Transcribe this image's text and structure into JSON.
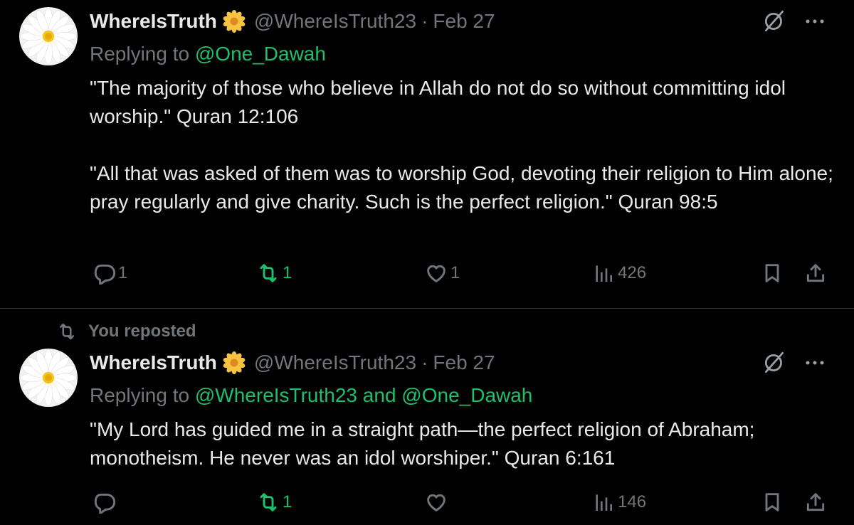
{
  "colors": {
    "background": "#000000",
    "text": "#e7e9ea",
    "muted": "#71767b",
    "accent": "#1fbf6b",
    "divider": "#2f3336"
  },
  "tweets": [
    {
      "name": "WhereIsTruth",
      "badge_icon": "daisy-flower",
      "handle": "@WhereIsTruth23",
      "sep": "·",
      "date": "Feb 27",
      "replying_prefix": "Replying to ",
      "mention1": "@One_Dawah",
      "paragraphs": [
        "\"The majority of those who believe in Allah do not do so without committing idol worship.\" Quran 12:106",
        "\"All that was asked of them was to worship God, devoting their religion to Him alone; pray regularly and give charity. Such is the perfect religion.\" Quran 98:5"
      ],
      "reply_count": "1",
      "repost_count": "1",
      "like_count": "1",
      "view_count": "426"
    },
    {
      "repost_label": "You reposted",
      "name": "WhereIsTruth",
      "badge_icon": "daisy-flower",
      "handle": "@WhereIsTruth23",
      "sep": "·",
      "date": "Feb 27",
      "replying_prefix": "Replying to ",
      "mention1": "@WhereIsTruth23",
      "mention_joiner": " and ",
      "mention2": "@One_Dawah",
      "paragraphs": [
        "\"My Lord has guided me in a straight path—the perfect religion of Abraham; monotheism. He never was an idol worshiper.\" Quran 6:161"
      ],
      "repost_count": "1",
      "view_count": "146"
    }
  ]
}
